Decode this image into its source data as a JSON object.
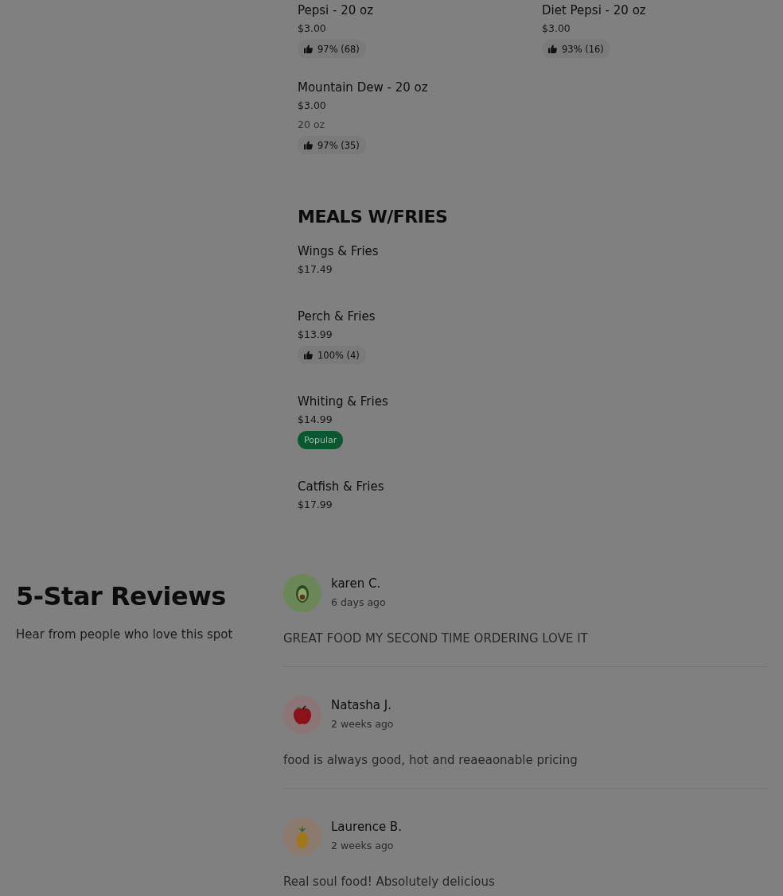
{
  "menu_sections": [
    {
      "items": [
        {
          "name": "Pepsi - 20 oz",
          "price": "$3.00",
          "rating": "97% (68)"
        },
        {
          "name": "Diet Pepsi - 20 oz",
          "price": "$3.00",
          "rating": "93% (16)"
        },
        {
          "name": "Mountain Dew - 20 oz",
          "price": "$3.00",
          "size": "20 oz",
          "rating": "97% (35)"
        }
      ]
    },
    {
      "title": "MEALS W/FRIES",
      "items": [
        {
          "name": "Wings & Fries",
          "price": "$17.49"
        },
        {
          "name": "Perch & Fries",
          "price": "$13.99",
          "rating": "100% (4)"
        },
        {
          "name": "Whiting & Fries",
          "price": "$14.99",
          "badge": "Popular"
        },
        {
          "name": "Catfish & Fries",
          "price": "$17.99"
        }
      ]
    }
  ],
  "reviews": {
    "title": "5-Star Reviews",
    "subtitle": "Hear from people who love this spot",
    "items": [
      {
        "author": "karen C.",
        "time": "6 days ago",
        "text": "GREAT FOOD MY SECOND TIME ORDERING LOVE IT"
      },
      {
        "author": "Natasha J.",
        "time": "2 weeks ago",
        "text": "food is always good, hot and reaeaonable pricing"
      },
      {
        "author": "Laurence B.",
        "time": "2 weeks ago",
        "text": "Real soul food! Absolutely delicious"
      }
    ]
  }
}
